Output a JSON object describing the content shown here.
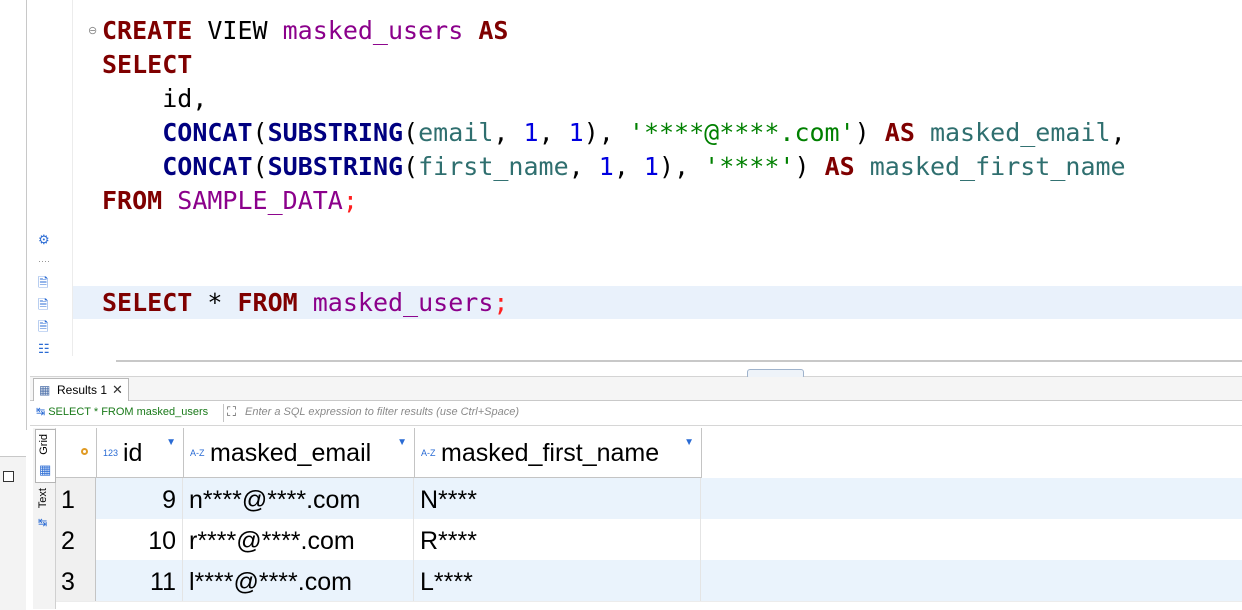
{
  "editor": {
    "lines": [
      [
        {
          "t": "CREATE",
          "c": "kw"
        },
        {
          "t": " VIEW ",
          "c": ""
        },
        {
          "t": "masked_users",
          "c": "tbl"
        },
        {
          "t": " ",
          "c": ""
        },
        {
          "t": "AS",
          "c": "kw"
        }
      ],
      [
        {
          "t": "SELECT",
          "c": "kw"
        }
      ],
      [
        {
          "t": "    id,",
          "c": ""
        }
      ],
      [
        {
          "t": "    ",
          "c": ""
        },
        {
          "t": "CONCAT",
          "c": "fn"
        },
        {
          "t": "(",
          "c": ""
        },
        {
          "t": "SUBSTRING",
          "c": "fn"
        },
        {
          "t": "(",
          "c": ""
        },
        {
          "t": "email",
          "c": "col"
        },
        {
          "t": ", ",
          "c": ""
        },
        {
          "t": "1",
          "c": "num"
        },
        {
          "t": ", ",
          "c": ""
        },
        {
          "t": "1",
          "c": "num"
        },
        {
          "t": "), ",
          "c": ""
        },
        {
          "t": "'****@****.com'",
          "c": "str"
        },
        {
          "t": ") ",
          "c": ""
        },
        {
          "t": "AS",
          "c": "kw"
        },
        {
          "t": " ",
          "c": ""
        },
        {
          "t": "masked_email",
          "c": "col"
        },
        {
          "t": ",",
          "c": ""
        }
      ],
      [
        {
          "t": "    ",
          "c": ""
        },
        {
          "t": "CONCAT",
          "c": "fn"
        },
        {
          "t": "(",
          "c": ""
        },
        {
          "t": "SUBSTRING",
          "c": "fn"
        },
        {
          "t": "(",
          "c": ""
        },
        {
          "t": "first_name",
          "c": "col"
        },
        {
          "t": ", ",
          "c": ""
        },
        {
          "t": "1",
          "c": "num"
        },
        {
          "t": ", ",
          "c": ""
        },
        {
          "t": "1",
          "c": "num"
        },
        {
          "t": "), ",
          "c": ""
        },
        {
          "t": "'****'",
          "c": "str"
        },
        {
          "t": ") ",
          "c": ""
        },
        {
          "t": "AS",
          "c": "kw"
        },
        {
          "t": " ",
          "c": ""
        },
        {
          "t": "masked_first_name",
          "c": "col"
        }
      ],
      [
        {
          "t": "FROM",
          "c": "kw"
        },
        {
          "t": " ",
          "c": ""
        },
        {
          "t": "SAMPLE_DATA",
          "c": "tbl"
        },
        {
          "t": ";",
          "c": "semi"
        }
      ],
      [],
      [],
      [
        {
          "t": "SELECT",
          "c": "kw"
        },
        {
          "t": " * ",
          "c": ""
        },
        {
          "t": "FROM",
          "c": "kw"
        },
        {
          "t": " ",
          "c": ""
        },
        {
          "t": "masked_users",
          "c": "tbl"
        },
        {
          "t": ";",
          "c": "semi"
        }
      ]
    ]
  },
  "results": {
    "tab_label": "Results 1",
    "query_text": "SELECT * FROM masked_users",
    "filter_placeholder": "Enter a SQL expression to filter results (use Ctrl+Space)",
    "side_tabs": {
      "grid": "Grid",
      "text": "Text"
    },
    "columns": [
      {
        "name": "id",
        "type_icon": "123"
      },
      {
        "name": "masked_email",
        "type_icon": "A-Z"
      },
      {
        "name": "masked_first_name",
        "type_icon": "A-Z"
      }
    ],
    "rows": [
      {
        "num": "1",
        "id": "9",
        "masked_email": "n****@****.com",
        "masked_first_name": "N****"
      },
      {
        "num": "2",
        "id": "10",
        "masked_email": "r****@****.com",
        "masked_first_name": "R****"
      },
      {
        "num": "3",
        "id": "11",
        "masked_email": "l****@****.com",
        "masked_first_name": "L****"
      }
    ]
  }
}
